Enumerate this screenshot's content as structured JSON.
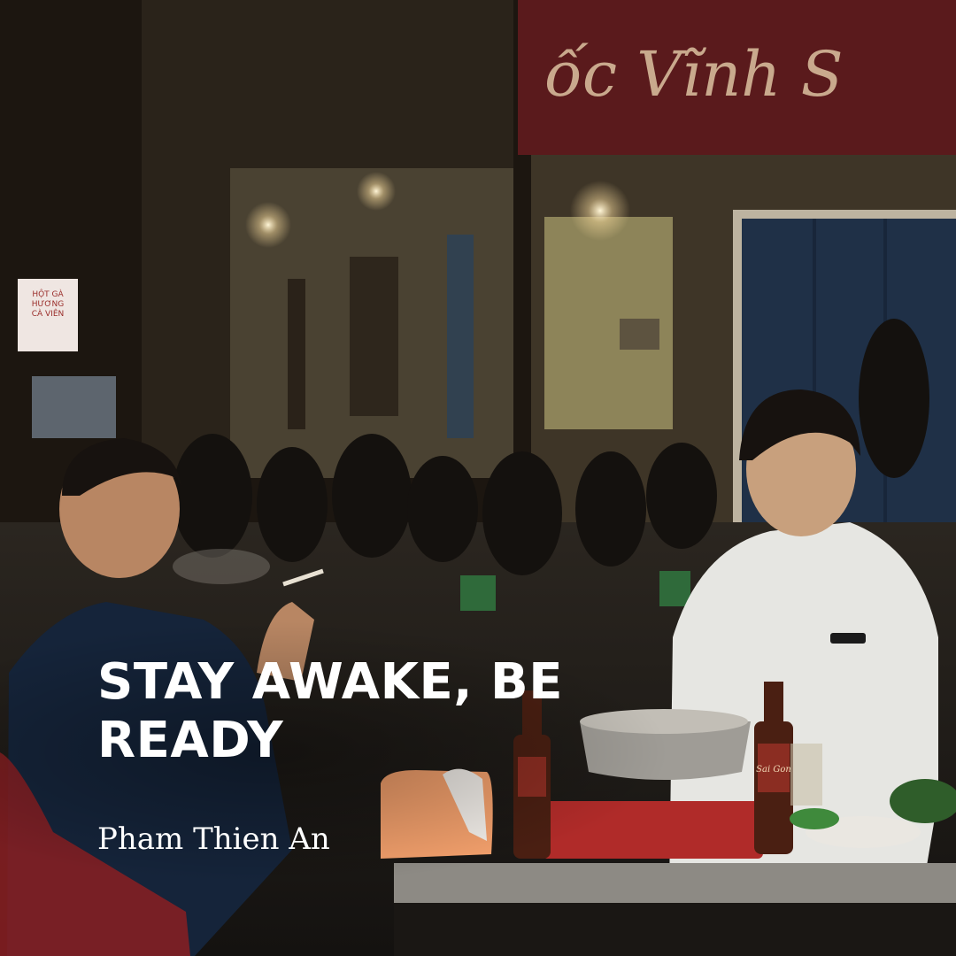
{
  "poster": {
    "title": "STAY AWAKE, BE READY",
    "credit": "Pham Thien An"
  },
  "scene": {
    "shop_sign": "ốc Vĩnh S",
    "street_sign": "HỘT GÀ\nHƯƠNG\nCÀ VIÊN",
    "bottle_label": "Sai Gon"
  }
}
